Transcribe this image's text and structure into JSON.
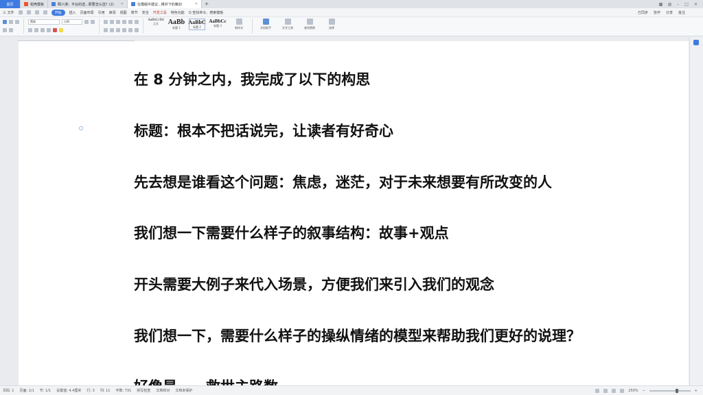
{
  "tabs": [
    {
      "label": "首页"
    },
    {
      "label": "稻壳模板"
    },
    {
      "label": "瞬六课：平台的选...那要怎么选？(2)"
    },
    {
      "label": "在模版中建议...推并下的策划"
    }
  ],
  "tab_new": "+",
  "menu": {
    "file": "三 文件",
    "items": [
      "开始",
      "插入",
      "页面布局",
      "引用",
      "审阅",
      "视图",
      "章节",
      "安全",
      "开发工具",
      "特色功能"
    ],
    "search": "Q 查找命令、搜索模板",
    "right": [
      "已同步",
      "协作",
      "分享",
      "批注"
    ]
  },
  "ribbon": {
    "font_name": "黑体",
    "font_size": "小四",
    "styles": [
      {
        "sample": "AaBbCcDd",
        "label": "正文"
      },
      {
        "sample": "AaBb",
        "label": "标题 1"
      },
      {
        "sample": "AaBbC",
        "label": "标题 2"
      },
      {
        "sample": "AaBbCc",
        "label": "标题 3"
      }
    ],
    "new_style": "新样式",
    "text_tools": "文字工具",
    "doc_assist": "文档助手",
    "find_replace": "查找替换",
    "select": "选择"
  },
  "document": {
    "lines": [
      "在 8 分钟之内，我完成了以下的构思",
      "标题：根本不把话说完，让读者有好奇心",
      "先去想是谁看这个问题：焦虑，迷茫，对于未来想要有所改变的人",
      "我们想一下需要什么样子的叙事结构：故事+观点",
      "开头需要大例子来代入场景，方便我们来引入我们的观念",
      "我们想一下，需要什么样子的操纵情绪的模型来帮助我们更好的说理？",
      "好像是……救世主路数"
    ]
  },
  "status": {
    "page_num": "页码: 1",
    "pages": "页面: 1/1",
    "section": "节: 1/1",
    "settings": "设置值: 4.4厘米",
    "row": "行: 3",
    "col": "列: 11",
    "words": "字数: 731",
    "spell": "拼写检查",
    "doc_check": "文档校对",
    "protect": "文档未保护",
    "zoom": "250%"
  }
}
